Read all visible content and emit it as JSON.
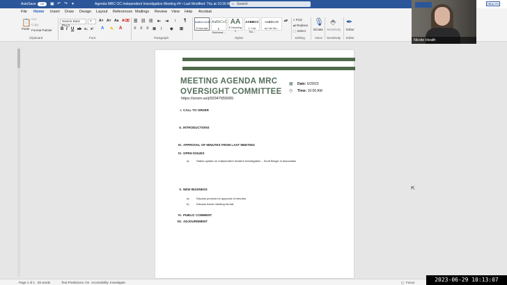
{
  "titlebar": {
    "autosave_label": "AutoSave",
    "autosave_state": "Off",
    "doc_title": "Agenda MRC OC Independent Investigation Meeting ##  •  Last Modified: Thu at 10:30 AM",
    "search_placeholder": "Search"
  },
  "menu": [
    "File",
    "Home",
    "Insert",
    "Draw",
    "Design",
    "Layout",
    "References",
    "Mailings",
    "Review",
    "View",
    "Help",
    "Acrobat"
  ],
  "ribbon": {
    "clipboard": {
      "paste": "Paste",
      "cut": "Cut",
      "copy": "Copy",
      "format_painter": "Format Painter",
      "label": "Clipboard"
    },
    "font": {
      "name": "Source Sans Pro (I",
      "size": "7",
      "label": "Font"
    },
    "paragraph": {
      "label": "Paragraph"
    },
    "styles": {
      "items": [
        {
          "sample": "AaBbCcDdE",
          "name": "¶ Normal"
        },
        {
          "sample": "AaBbCcC",
          "name": "¶ Subhead..."
        },
        {
          "sample": "AA",
          "name": "¶ Heading 1"
        },
        {
          "sample": "AABBCC",
          "name": "1. List Nu..."
        },
        {
          "sample": "AaBbCcD",
          "name": "a) List Nu..."
        }
      ],
      "label": "Styles"
    },
    "editing": {
      "find": "Find",
      "replace": "Replace",
      "select": "Select",
      "label": "Editing"
    },
    "voice": {
      "dictate": "Dictate",
      "label": "Voice"
    },
    "sensitivity": {
      "name": "Sensitivity",
      "label": "Sensitivity"
    },
    "editor": {
      "name": "Editor",
      "label": "Editor"
    }
  },
  "document": {
    "heading_line1": "MEETING AGENDA MRC",
    "heading_line2": "OVERSIGHT COMMITTEE",
    "zoom_link": "https://zoom.us/j/93347655065",
    "date_label": "Date:",
    "date_value": "6/29/23",
    "time_label": "Time:",
    "time_value": "10:00 AM",
    "agenda": [
      {
        "num": "I.",
        "title": "CALL TO ORDER"
      },
      {
        "num": "II.",
        "title": "INTRODUCTIONS"
      },
      {
        "num": "III.",
        "title": "APPROVAL OF MINUTES FROM LAST MEETING"
      },
      {
        "num": "IV.",
        "title": "OPEN ISSUES"
      },
      {
        "num": "V.",
        "title": "NEW BUSINESS"
      },
      {
        "num": "VI.",
        "title": "PUBLIC COMMENT"
      },
      {
        "num": "VII.",
        "title": "ADJOURNMENT"
      }
    ],
    "open_issues_sub": {
      "letter": "a)",
      "text": "Status update on Independent Incident Investigation – Scott Berger & Associates"
    },
    "new_business_sub": [
      {
        "letter": "a)",
        "text": "Discuss process for approval of minutes."
      },
      {
        "letter": "b)",
        "text": "Discuss future meeting format."
      }
    ]
  },
  "status": {
    "page": "Page 1 of 1",
    "words": "50 words",
    "predictions": "Text Predictions: On",
    "accessibility": "Accessibility: Investigate",
    "focus": "Focus"
  },
  "video": {
    "participant": "Nicole Heath"
  },
  "timestamp": "2023-06-29 10:13:07"
}
